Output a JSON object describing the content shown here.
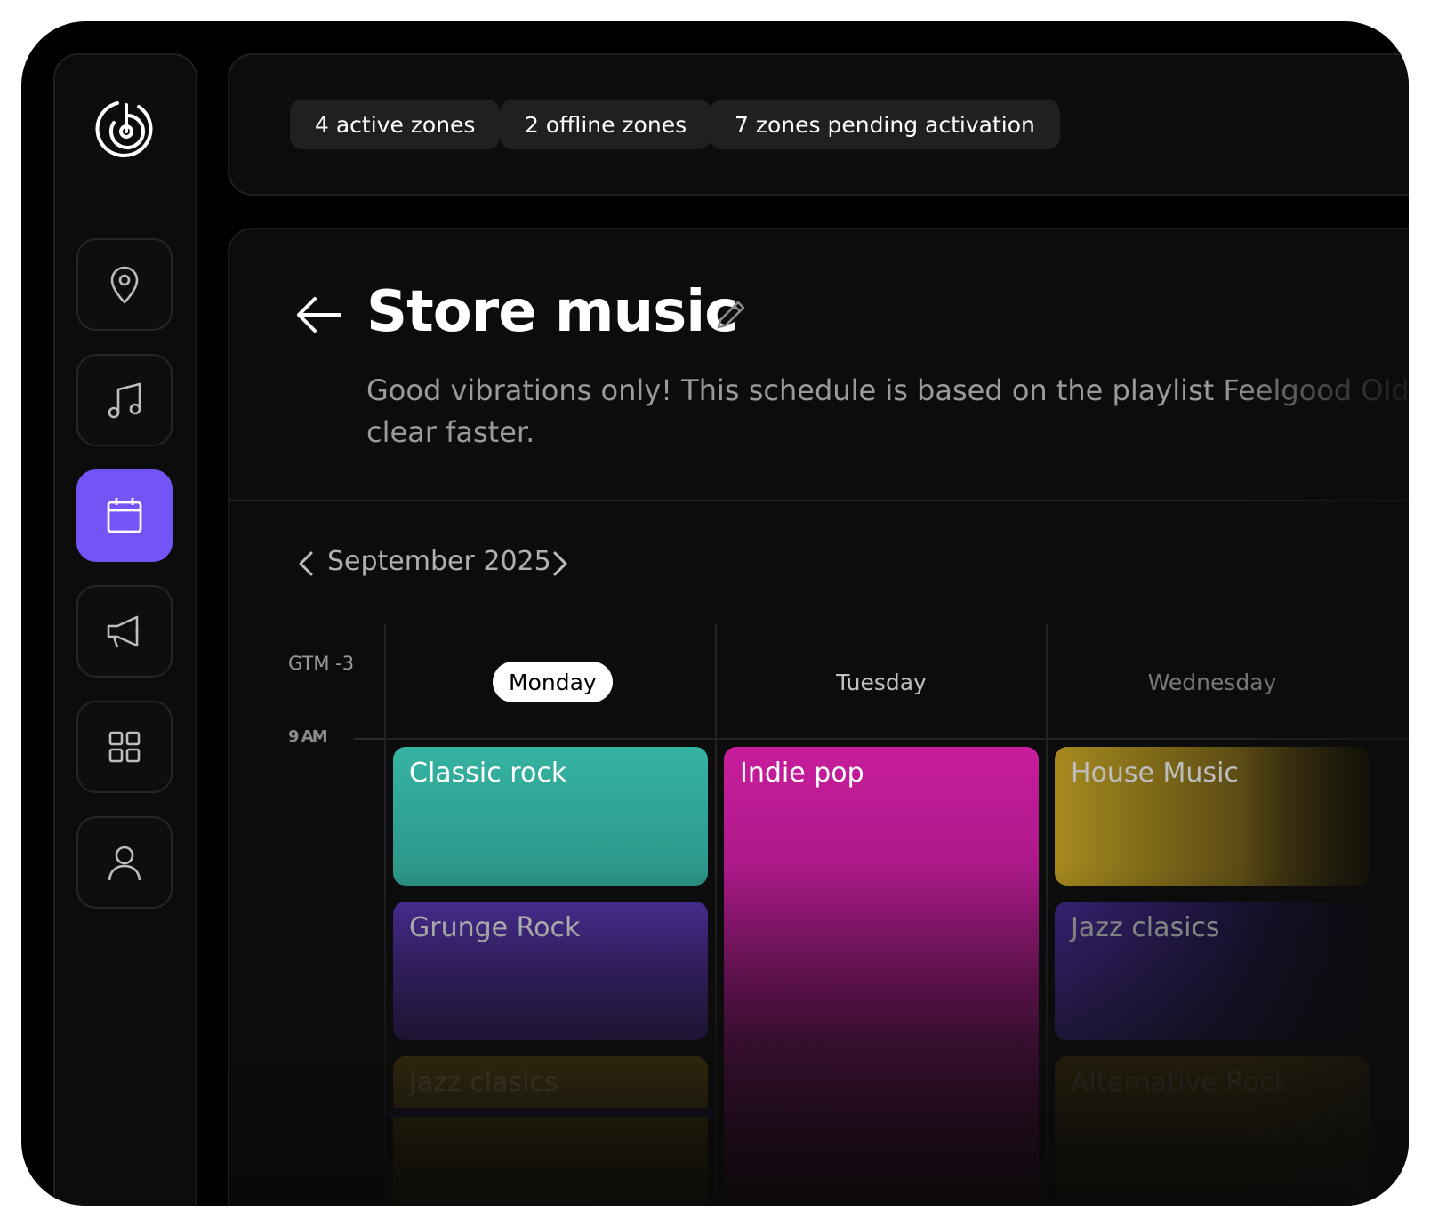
{
  "sidebar": {
    "logo": "brand-logo",
    "items": [
      {
        "icon": "location-pin-icon",
        "active": false
      },
      {
        "icon": "music-note-icon",
        "active": false
      },
      {
        "icon": "calendar-icon",
        "active": true
      },
      {
        "icon": "megaphone-icon",
        "active": false
      },
      {
        "icon": "grid-icon",
        "active": false
      },
      {
        "icon": "user-icon",
        "active": false
      }
    ],
    "accent": "#7554f7"
  },
  "topbar": {
    "chips": [
      "4 active zones",
      "2 offline zones",
      "7 zones pending activation"
    ]
  },
  "page": {
    "title": "Store music",
    "description": "Good vibrations only! This schedule is based on the playlist Feelgood Oldie clear faster."
  },
  "calendar": {
    "month": "September 2025",
    "timezone": "GTM -3",
    "first_time": "9 AM",
    "days": [
      "Monday",
      "Tuesday",
      "Wednesday"
    ],
    "active_day": "Monday",
    "events": {
      "monday": [
        "Classic rock",
        "Grunge Rock",
        "Jazz clasics"
      ],
      "tuesday": [
        "Indie pop"
      ],
      "wednesday": [
        "House Music",
        "Jazz clasics",
        "Alternative Rock"
      ]
    },
    "colors": {
      "classic_rock": "#33b1a3",
      "grunge_rock": "#4a2e94",
      "jazz_monday": "#6a5410",
      "indie_pop": "#c81d9c",
      "house_music": "#9f8520",
      "jazz_wednesday": "#3b2480",
      "alternative_rock": "#5a4410"
    }
  }
}
